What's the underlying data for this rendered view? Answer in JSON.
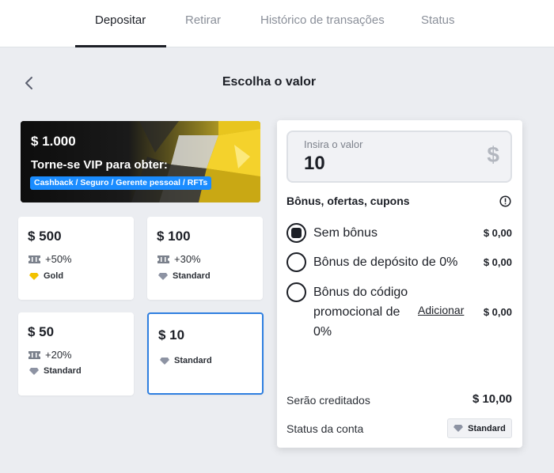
{
  "tabs": [
    {
      "label": "Depositar",
      "active": true
    },
    {
      "label": "Retirar"
    },
    {
      "label": "Histórico de transações"
    },
    {
      "label": "Status"
    }
  ],
  "page_title": "Escolha o valor",
  "vip": {
    "amount": "$ 1.000",
    "text": "Torne-se VIP para obter:",
    "badge": "Cashback / Seguro / Gerente pessoal / RFTs"
  },
  "cards": [
    {
      "amount": "$ 500",
      "bonus": "+50%",
      "status": "Gold"
    },
    {
      "amount": "$ 100",
      "bonus": "+30%",
      "status": "Standard"
    },
    {
      "amount": "$ 50",
      "bonus": "+20%",
      "status": "Standard"
    },
    {
      "amount": "$ 10",
      "status": "Standard",
      "selected": true
    }
  ],
  "deposit": {
    "input_label": "Insira o valor",
    "input_value": "10",
    "currency_icon": "dollar-icon",
    "bonus_title": "Bônus, ofertas, cupons",
    "options": [
      {
        "label": "Sem bônus",
        "value": "$ 0,00",
        "selected": true
      },
      {
        "label": "Bônus de depósito de 0%",
        "value": "$ 0,00"
      },
      {
        "label_lines": [
          "Bônus do código",
          "promocional de",
          "0%"
        ],
        "value": "$ 0,00",
        "action": "Adicionar"
      }
    ],
    "credit_label": "Serão creditados",
    "credit_value": "$ 10,00",
    "status_label": "Status da conta",
    "status_value": "Standard"
  },
  "colors": {
    "accent": "#2f7fe0",
    "vip_yellow": "#f4d22c",
    "vip_badge": "#1a8cff",
    "gold": "#f2c200"
  }
}
